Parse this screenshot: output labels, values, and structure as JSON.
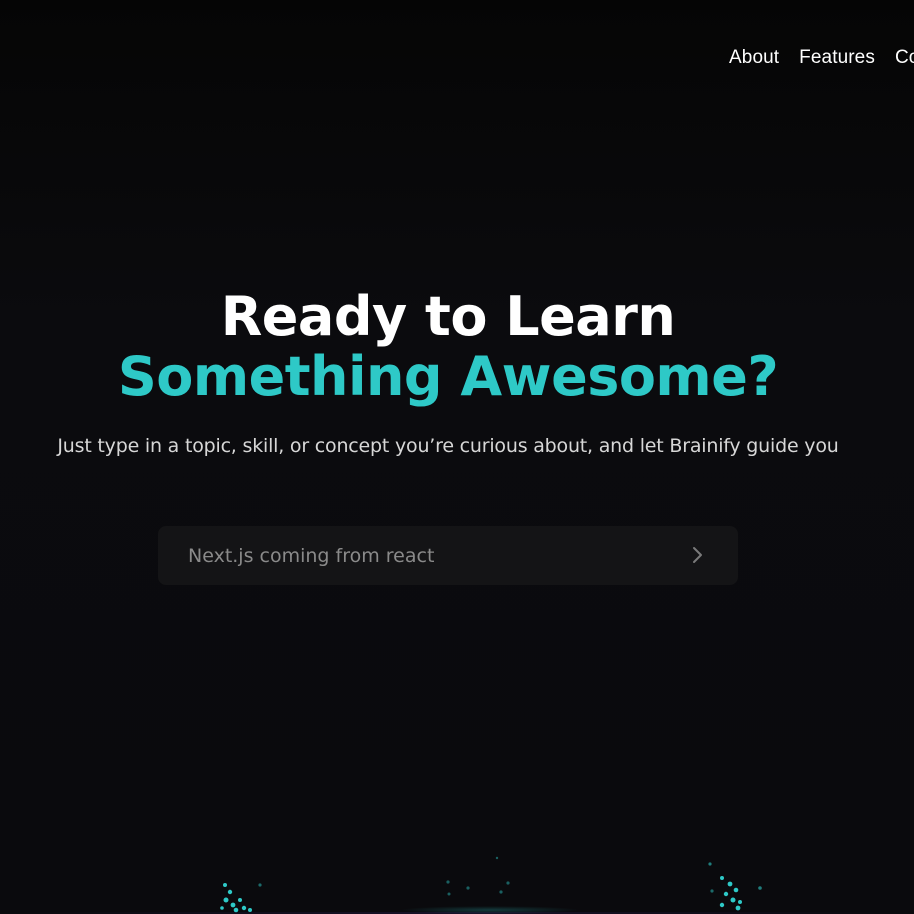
{
  "nav": {
    "items": [
      {
        "label": "About"
      },
      {
        "label": "Features"
      },
      {
        "label": "Co"
      }
    ]
  },
  "hero": {
    "title_line1": "Ready to Learn",
    "title_line2": "Something Awesome?",
    "subtitle": "Just type in a topic, skill, or concept you’re curious about, and let Brainify guide you"
  },
  "search": {
    "placeholder": "Next.js coming from react",
    "value": ""
  },
  "colors": {
    "accent": "#2ec9c7",
    "background": "#09090b",
    "input_background": "#141416"
  },
  "icons": {
    "submit": "chevron-right-icon",
    "decor": "particle-cluster-icon"
  }
}
